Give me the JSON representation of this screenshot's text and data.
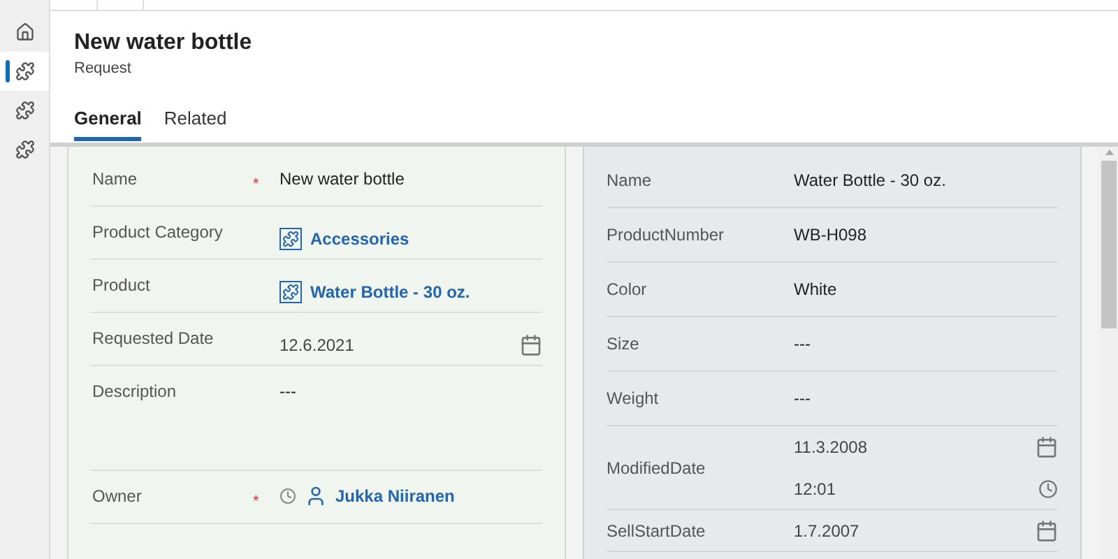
{
  "sidebar": {
    "items": [
      {
        "kind": "home",
        "selected": false
      },
      {
        "kind": "entity",
        "selected": true
      },
      {
        "kind": "entity",
        "selected": false
      },
      {
        "kind": "entity",
        "selected": false
      }
    ]
  },
  "header": {
    "title": "New water bottle",
    "subtitle": "Request"
  },
  "tabs": [
    {
      "label": "General",
      "selected": true
    },
    {
      "label": "Related",
      "selected": false
    }
  ],
  "request_fields": [
    {
      "label": "Name",
      "required_mark": "*",
      "kind": "text",
      "value": "New water bottle"
    },
    {
      "label": "Product Category",
      "kind": "lookup",
      "value": "Accessories"
    },
    {
      "label": "Product",
      "kind": "lookup",
      "value": "Water Bottle - 30 oz."
    },
    {
      "label": "Requested Date",
      "kind": "date",
      "value": "12.6.2021"
    },
    {
      "label": "Description",
      "kind": "multiline",
      "value": "---"
    },
    {
      "label": "Owner",
      "required_mark": "*",
      "kind": "owner",
      "value": "Jukka Niiranen"
    }
  ],
  "product_fields": [
    {
      "label": "Name",
      "kind": "text",
      "value": "Water Bottle - 30 oz."
    },
    {
      "label": "ProductNumber",
      "kind": "text",
      "value": "WB-H098"
    },
    {
      "label": "Color",
      "kind": "text",
      "value": "White"
    },
    {
      "label": "Size",
      "kind": "text",
      "value": "---"
    },
    {
      "label": "Weight",
      "kind": "text",
      "value": "---"
    },
    {
      "label": "ModifiedDate",
      "kind": "datetime",
      "value": "11.3.2008",
      "time": "12:01"
    },
    {
      "label": "SellStartDate",
      "kind": "date",
      "value": "1.7.2007"
    }
  ]
}
